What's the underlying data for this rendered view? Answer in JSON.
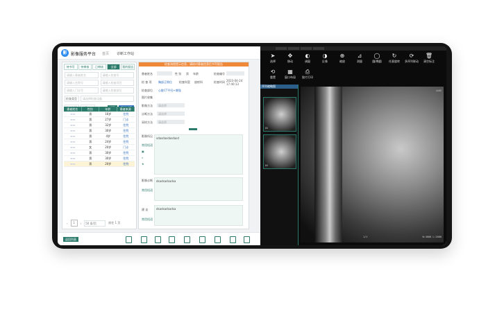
{
  "app": {
    "brand": "影像服务平台",
    "crumb_home": "首页",
    "crumb_current": "诊断工作站"
  },
  "left": {
    "tabs": [
      "待书写",
      "待审核",
      "已审核",
      "全部",
      "我的报告"
    ],
    "filters": [
      [
        "请输入患者姓名",
        "请输入检查号"
      ],
      [
        "请输入住院号",
        "请输入检查项目"
      ],
      [
        "请输入门诊号",
        "请输入检查部位"
      ]
    ],
    "modality_label": "检查类型",
    "modality_placeholder": "请选择检查设备",
    "time_label": "检查时间",
    "time_value": "本周",
    "search_label": "搜索",
    "advanced_label": "高级搜索",
    "columns": [
      "患者姓名",
      "性别",
      "年龄",
      "患者来源"
    ],
    "rows": [
      [
        "男",
        "16岁",
        "住院"
      ],
      [
        "男",
        "27岁",
        "门诊"
      ],
      [
        "男",
        "32岁",
        "住院"
      ],
      [
        "男",
        "30岁",
        "住院"
      ],
      [
        "男",
        "4岁",
        "住院"
      ],
      [
        "男",
        "24岁",
        "住院"
      ],
      [
        "女",
        "20岁",
        "门诊"
      ],
      [
        "男",
        "30岁",
        "住院"
      ],
      [
        "男",
        "30岁",
        "住院"
      ],
      [
        "男",
        "20岁",
        "住院"
      ]
    ],
    "pager": {
      "page": "1",
      "size": "50 条/页",
      "jump": "前往 1 页"
    }
  },
  "form": {
    "notice": "检查流程提示信息，请核对患者信息后书写报告",
    "name_label": "患者姓名",
    "gender_label": "性 别",
    "gender_value": "男",
    "age_label": "年龄",
    "exam_no_label": "检查编号",
    "exam_type_label": "检 查 项",
    "exam_item": "胸部正侧位",
    "dept_label": "检查科室",
    "dept_value": "放射科",
    "body_label": "检查部位",
    "body_value": "心脏CT平扫+增强",
    "time_label": "检查时间",
    "time_value": "2023-04-24 17:40:13",
    "checkbox_label": "图片收集",
    "fields": [
      {
        "label": "影像方法",
        "placeholder": "请选择"
      },
      {
        "label": "诊断方法",
        "placeholder": "请选择"
      },
      {
        "label": "采样方法",
        "placeholder": "请选择"
      }
    ],
    "desc_label": "影像所见",
    "desc_value": "sdasdasdasdasd",
    "conc_label": "影像诊断",
    "conc_value": "dsadsadsadsa",
    "advice_label": "建 议",
    "advice_value": "dsadsadsadsa",
    "template_label": "常用短语"
  },
  "bottom": {
    "left_button": "返回列表"
  },
  "viewer": {
    "tools": [
      {
        "label": "选择",
        "icon": "cursor-icon"
      },
      {
        "label": "移动",
        "icon": "move-icon"
      },
      {
        "label": "调窗",
        "icon": "contrast-icon"
      },
      {
        "label": "反像",
        "icon": "invert-icon"
      },
      {
        "label": "缩放",
        "icon": "zoom-icon"
      },
      {
        "label": "测量",
        "icon": "ruler-icon"
      },
      {
        "label": "圆/椭圆",
        "icon": "ellipse-icon"
      },
      {
        "label": "任意旋转",
        "icon": "rotate-icon"
      },
      {
        "label": "多序列联动",
        "icon": "sync-icon"
      },
      {
        "label": "清空标注",
        "icon": "trash-icon"
      }
    ],
    "tools2": [
      {
        "label": "重置",
        "icon": "reset-icon"
      },
      {
        "label": "窗口布局",
        "icon": "layout-icon"
      },
      {
        "label": "胶片打印",
        "icon": "print-icon"
      }
    ],
    "series_title": "序列缩略图",
    "thumbs": [
      {
        "label": "DX"
      },
      {
        "label": "DX"
      }
    ],
    "overlay_right": "LAUS",
    "zoom_text": "W:4000 L:2000",
    "pos_text": "1/1"
  }
}
